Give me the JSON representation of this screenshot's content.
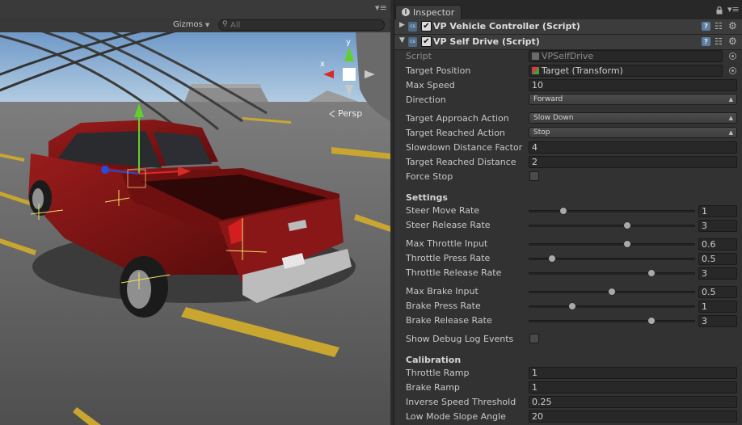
{
  "scene": {
    "gizmos_label": "Gizmos",
    "search_placeholder": "All",
    "persp_label": "Persp",
    "axis_labels": {
      "y": "y",
      "x": "x"
    }
  },
  "inspector": {
    "tab_title": "Inspector",
    "components": [
      {
        "name": "VP Vehicle Controller (Script)",
        "enabled": true,
        "expanded": false
      },
      {
        "name": "VP Self Drive (Script)",
        "enabled": true,
        "expanded": true
      }
    ],
    "fields": {
      "script": {
        "label": "Script",
        "value": "VPSelfDrive"
      },
      "target_position": {
        "label": "Target Position",
        "value": "Target (Transform)"
      },
      "max_speed": {
        "label": "Max Speed",
        "value": "10"
      },
      "direction": {
        "label": "Direction",
        "value": "Forward"
      },
      "target_approach_action": {
        "label": "Target Approach Action",
        "value": "Slow Down"
      },
      "target_reached_action": {
        "label": "Target Reached Action",
        "value": "Stop"
      },
      "slowdown_distance_factor": {
        "label": "Slowdown Distance Factor",
        "value": "4"
      },
      "target_reached_distance": {
        "label": "Target Reached Distance",
        "value": "2"
      },
      "force_stop": {
        "label": "Force Stop",
        "checked": false
      }
    },
    "settings": {
      "title": "Settings",
      "sliders": [
        {
          "label": "Steer Move Rate",
          "value": "1",
          "fraction": 0.21
        },
        {
          "label": "Steer Release Rate",
          "value": "3",
          "fraction": 0.59
        },
        {
          "label": "Max Throttle Input",
          "value": "0.6",
          "fraction": 0.59
        },
        {
          "label": "Throttle Press Rate",
          "value": "0.5",
          "fraction": 0.14
        },
        {
          "label": "Throttle Release Rate",
          "value": "3",
          "fraction": 0.74
        },
        {
          "label": "Max Brake Input",
          "value": "0.5",
          "fraction": 0.5
        },
        {
          "label": "Brake Press Rate",
          "value": "1",
          "fraction": 0.26
        },
        {
          "label": "Brake Release Rate",
          "value": "3",
          "fraction": 0.74
        }
      ],
      "show_debug_log_events": {
        "label": "Show Debug Log Events",
        "checked": false
      }
    },
    "calibration": {
      "title": "Calibration",
      "throttle_ramp": {
        "label": "Throttle Ramp",
        "value": "1"
      },
      "brake_ramp": {
        "label": "Brake Ramp",
        "value": "1"
      },
      "inverse_speed_threshold": {
        "label": "Inverse Speed Threshold",
        "value": "0.25"
      },
      "low_mode_slope_angle": {
        "label": "Low Mode Slope Angle",
        "value": "20"
      }
    }
  },
  "colors": {
    "inspector_bg": "#323232",
    "scene_sky": "#8fb4d8",
    "road": "#595959",
    "truck_body": "#7a1414",
    "gizmo_y": "#5fd12a",
    "gizmo_x": "#d92a2a",
    "gizmo_z": "#2a4ad9"
  }
}
